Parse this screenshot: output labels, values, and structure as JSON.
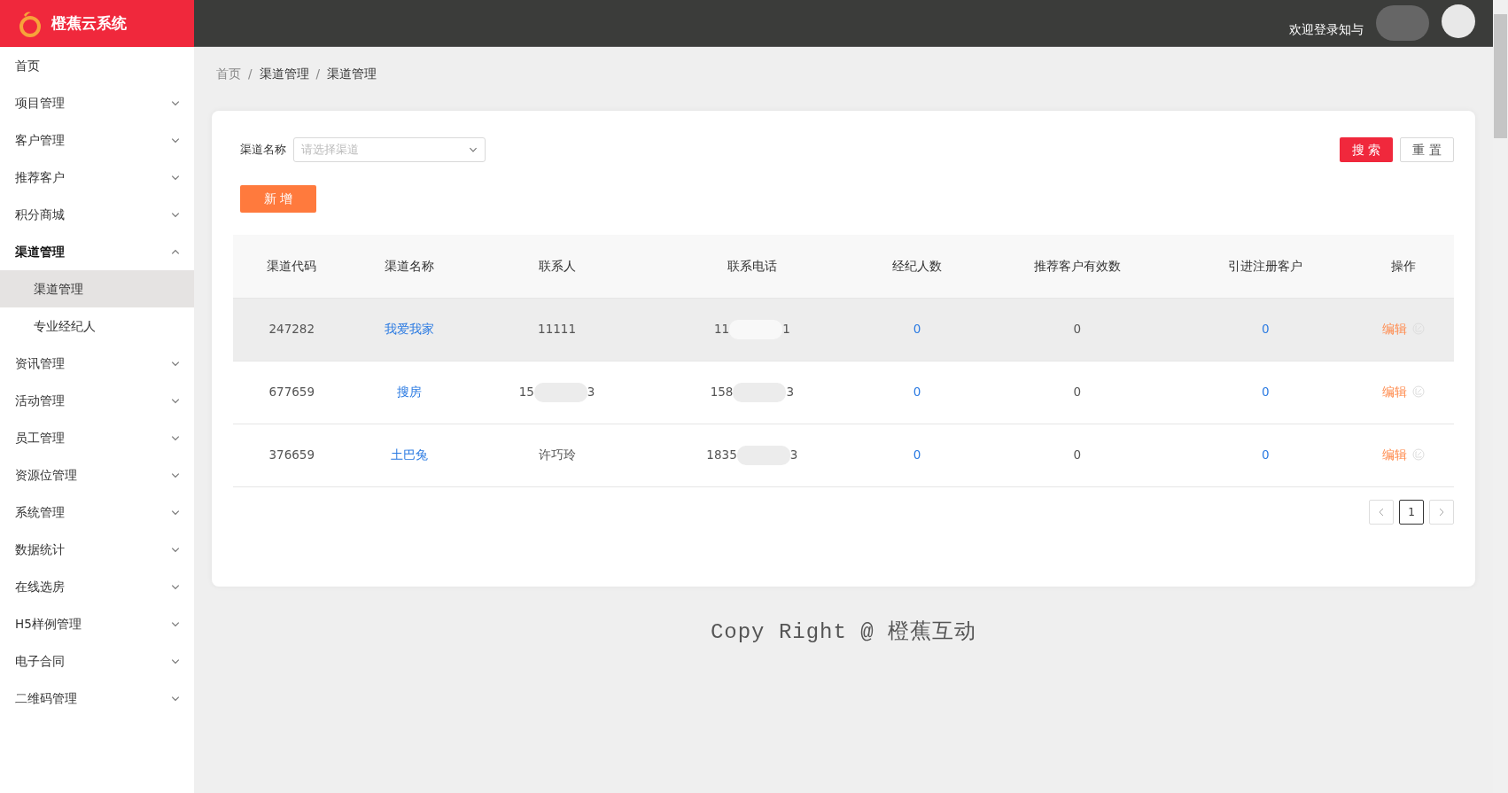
{
  "app": {
    "title": "橙蕉云系统"
  },
  "header": {
    "welcome": "欢迎登录知与"
  },
  "sidebar": {
    "items": [
      {
        "label": "首页",
        "kind": "link"
      },
      {
        "label": "项目管理",
        "kind": "group",
        "expanded": false
      },
      {
        "label": "客户管理",
        "kind": "group",
        "expanded": false
      },
      {
        "label": "推荐客户",
        "kind": "group",
        "expanded": false
      },
      {
        "label": "积分商城",
        "kind": "group",
        "expanded": false
      },
      {
        "label": "渠道管理",
        "kind": "group",
        "expanded": true,
        "children": [
          {
            "label": "渠道管理",
            "selected": true
          },
          {
            "label": "专业经纪人",
            "selected": false
          }
        ]
      },
      {
        "label": "资讯管理",
        "kind": "group",
        "expanded": false
      },
      {
        "label": "活动管理",
        "kind": "group",
        "expanded": false
      },
      {
        "label": "员工管理",
        "kind": "group",
        "expanded": false
      },
      {
        "label": "资源位管理",
        "kind": "group",
        "expanded": false
      },
      {
        "label": "系统管理",
        "kind": "group",
        "expanded": false
      },
      {
        "label": "数据统计",
        "kind": "group",
        "expanded": false
      },
      {
        "label": "在线选房",
        "kind": "group",
        "expanded": false
      },
      {
        "label": "H5样例管理",
        "kind": "group",
        "expanded": false
      },
      {
        "label": "电子合同",
        "kind": "group",
        "expanded": false
      },
      {
        "label": "二维码管理",
        "kind": "group",
        "expanded": false
      }
    ]
  },
  "breadcrumb": {
    "separator": "/",
    "items": [
      "首页",
      "渠道管理",
      "渠道管理"
    ]
  },
  "filter": {
    "label": "渠道名称",
    "placeholder": "请选择渠道",
    "search_button": "搜 索",
    "reset_button": "重 置"
  },
  "add_button": "新 增",
  "table": {
    "columns": [
      "渠道代码",
      "渠道名称",
      "联系人",
      "联系电话",
      "经纪人数",
      "推荐客户有效数",
      "引进注册客户",
      "操作"
    ],
    "rows": [
      {
        "hovered": true,
        "code": "247282",
        "name": "我爱我家",
        "contact": {
          "prefix": "11111"
        },
        "phone": {
          "prefix": "11",
          "suffix": "1"
        },
        "agents": "0",
        "valid": "0",
        "registered": "0",
        "action": "编辑"
      },
      {
        "hovered": false,
        "code": "677659",
        "name": "搜房",
        "contact": {
          "prefix": "15",
          "suffix": "3"
        },
        "phone": {
          "prefix": "158",
          "suffix": "3"
        },
        "agents": "0",
        "valid": "0",
        "registered": "0",
        "action": "编辑"
      },
      {
        "hovered": false,
        "code": "376659",
        "name": "土巴兔",
        "contact": {
          "prefix": "许巧玲"
        },
        "phone": {
          "prefix": "1835",
          "suffix": "3"
        },
        "agents": "0",
        "valid": "0",
        "registered": "0",
        "action": "编辑"
      }
    ]
  },
  "pagination": {
    "pages": [
      {
        "label": "1",
        "selected": true
      }
    ]
  },
  "footer": "Copy Right @ 橙蕉互动"
}
